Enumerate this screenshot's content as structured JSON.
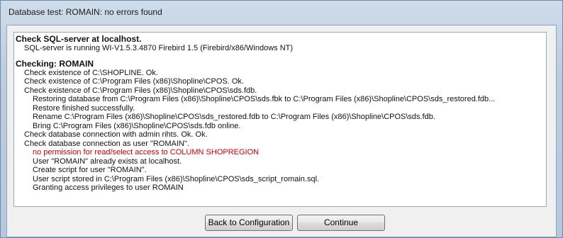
{
  "window": {
    "title": "Database test: ROMAIN: no errors found"
  },
  "log": {
    "lines": [
      {
        "text": "Check SQL-server at localhost.",
        "level": 1,
        "style": "heading"
      },
      {
        "text": "SQL-server is running WI-V1.5.3.4870 Firebird 1.5 (Firebird/x86/Windows NT)",
        "level": 2,
        "style": "normal"
      },
      {
        "text": "",
        "level": 1,
        "style": "gap"
      },
      {
        "text": "Checking: ROMAIN",
        "level": 1,
        "style": "heading"
      },
      {
        "text": "Check existence of C:\\SHOPLINE. Ok.",
        "level": 2,
        "style": "normal"
      },
      {
        "text": "Check existence of C:\\Program Files (x86)\\Shopline\\CPOS. Ok.",
        "level": 2,
        "style": "normal"
      },
      {
        "text": "Check existence of C:\\Program Files (x86)\\Shopline\\CPOS\\sds.fdb.",
        "level": 2,
        "style": "normal"
      },
      {
        "text": "Restoring database from C:\\Program Files (x86)\\Shopline\\CPOS\\sds.fbk to C:\\Program Files (x86)\\Shopline\\CPOS\\sds_restored.fdb...",
        "level": 3,
        "style": "normal"
      },
      {
        "text": "Restore finished successfully.",
        "level": 3,
        "style": "normal"
      },
      {
        "text": "Rename C:\\Program Files (x86)\\Shopline\\CPOS\\sds_restored.fdb to C:\\Program Files (x86)\\Shopline\\CPOS\\sds.fdb.",
        "level": 3,
        "style": "normal"
      },
      {
        "text": "Bring C:\\Program Files (x86)\\Shopline\\CPOS\\sds.fdb online.",
        "level": 3,
        "style": "normal"
      },
      {
        "text": "Check database connection with admin rihts. Ok. Ok.",
        "level": 2,
        "style": "normal"
      },
      {
        "text": "Check database connection as user \"ROMAIN\".",
        "level": 2,
        "style": "normal"
      },
      {
        "text": "no permission for read/select access to COLUMN SHOPREGION",
        "level": 3,
        "style": "error"
      },
      {
        "text": "User \"ROMAIN\" already exists at localhost.",
        "level": 3,
        "style": "normal"
      },
      {
        "text": "Create script for user \"ROMAIN\".",
        "level": 3,
        "style": "normal"
      },
      {
        "text": "User script stored in C:\\Program Files (x86)\\Shopline\\CPOS\\sds_script_romain.sql.",
        "level": 3,
        "style": "normal"
      },
      {
        "text": "Granting access privileges to user ROMAIN",
        "level": 3,
        "style": "normal"
      }
    ]
  },
  "buttons": {
    "back_label": "Back to Configuration",
    "continue_label": "Continue"
  },
  "colors": {
    "error_text": "#d00000",
    "title_bar": "#c4d4e6",
    "client_background": "#f0f0f0"
  }
}
